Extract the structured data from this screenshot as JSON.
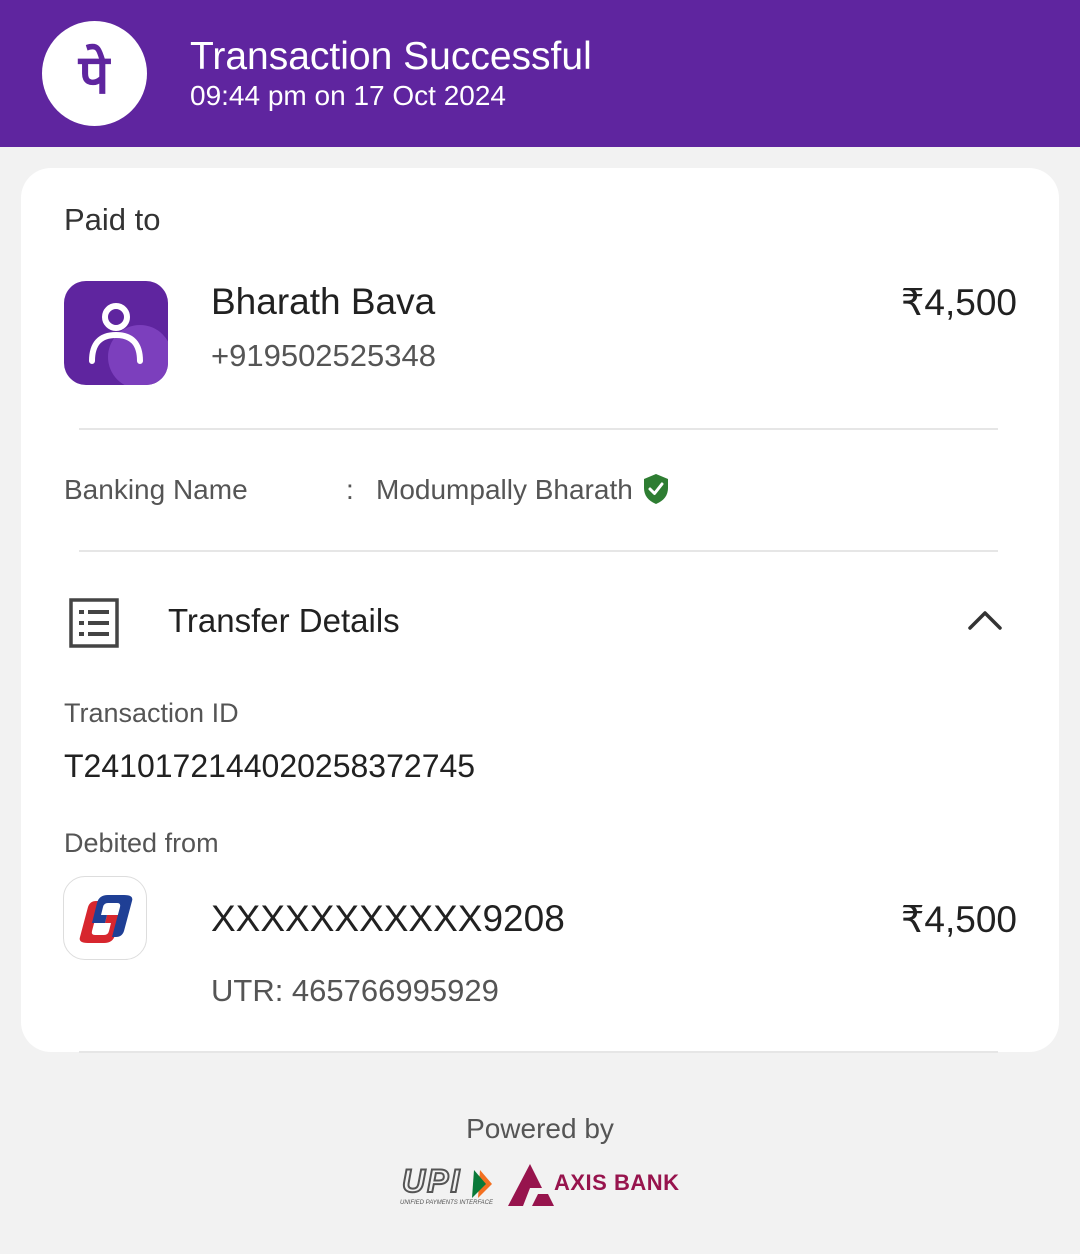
{
  "header": {
    "title": "Transaction Successful",
    "datetime": "09:44 pm on 17 Oct 2024",
    "logo_glyph": "पे",
    "brand_color": "#5f259f"
  },
  "payee": {
    "section_label": "Paid to",
    "name": "Bharath Bava",
    "phone": "+919502525348",
    "amount": "₹4,500",
    "avatar_icon": "person-icon"
  },
  "banking": {
    "label": "Banking Name",
    "separator": ":",
    "value": "Modumpally Bharath",
    "verified_icon": "verified-shield-icon",
    "verified_color": "#2e7d32"
  },
  "transfer_details": {
    "title": "Transfer Details",
    "expanded": true,
    "transaction_id_label": "Transaction ID",
    "transaction_id": "T2410172144020258372745",
    "debited_from_label": "Debited from",
    "account": "XXXXXXXXXXX9208",
    "amount": "₹4,500",
    "utr": "UTR: 465766995929",
    "bank_icon": "union-bank-icon"
  },
  "footer": {
    "powered_by": "Powered by",
    "upi_text": "UPI",
    "upi_tagline": "UNIFIED PAYMENTS INTERFACE",
    "partner": "AXIS BANK",
    "partner_color": "#97144d"
  }
}
